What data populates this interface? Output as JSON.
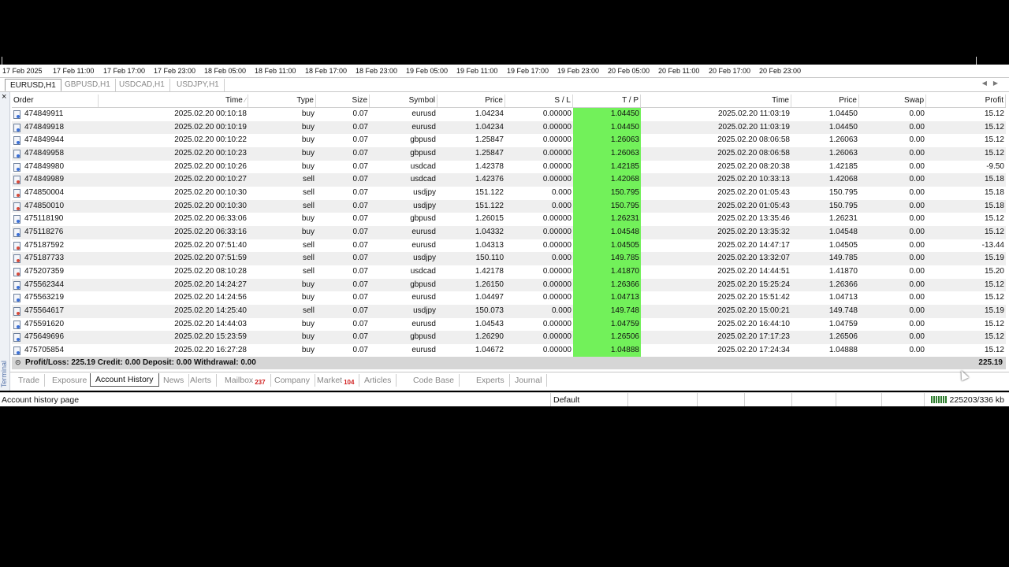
{
  "time_axis": [
    "17 Feb 2025",
    "17 Feb 11:00",
    "17 Feb 17:00",
    "17 Feb 23:00",
    "18 Feb 05:00",
    "18 Feb 11:00",
    "18 Feb 17:00",
    "18 Feb 23:00",
    "19 Feb 05:00",
    "19 Feb 11:00",
    "19 Feb 17:00",
    "19 Feb 23:00",
    "20 Feb 05:00",
    "20 Feb 11:00",
    "20 Feb 17:00",
    "20 Feb 23:00"
  ],
  "chart_tabs": [
    {
      "label": "EURUSD,H1",
      "active": true
    },
    {
      "label": "GBPUSD,H1",
      "active": false
    },
    {
      "label": "USDCAD,H1",
      "active": false
    },
    {
      "label": "USDJPY,H1",
      "active": false
    }
  ],
  "terminal": {
    "close_glyph": "×",
    "side_label": "Terminal",
    "columns": {
      "order": "Order",
      "open_time": "Time",
      "type": "Type",
      "size": "Size",
      "symbol": "Symbol",
      "open_price": "Price",
      "sl": "S / L",
      "tp": "T / P",
      "close_time": "Time",
      "close_price": "Price",
      "swap": "Swap",
      "profit": "Profit"
    },
    "rows": [
      {
        "order": "474849911",
        "open_time": "2025.02.20 00:10:18",
        "type": "buy",
        "size": "0.07",
        "symbol": "eurusd",
        "open_price": "1.04234",
        "sl": "0.00000",
        "tp": "1.04450",
        "close_time": "2025.02.20 11:03:19",
        "close_price": "1.04450",
        "swap": "0.00",
        "profit": "15.12"
      },
      {
        "order": "474849918",
        "open_time": "2025.02.20 00:10:19",
        "type": "buy",
        "size": "0.07",
        "symbol": "eurusd",
        "open_price": "1.04234",
        "sl": "0.00000",
        "tp": "1.04450",
        "close_time": "2025.02.20 11:03:19",
        "close_price": "1.04450",
        "swap": "0.00",
        "profit": "15.12"
      },
      {
        "order": "474849944",
        "open_time": "2025.02.20 00:10:22",
        "type": "buy",
        "size": "0.07",
        "symbol": "gbpusd",
        "open_price": "1.25847",
        "sl": "0.00000",
        "tp": "1.26063",
        "close_time": "2025.02.20 08:06:58",
        "close_price": "1.26063",
        "swap": "0.00",
        "profit": "15.12"
      },
      {
        "order": "474849958",
        "open_time": "2025.02.20 00:10:23",
        "type": "buy",
        "size": "0.07",
        "symbol": "gbpusd",
        "open_price": "1.25847",
        "sl": "0.00000",
        "tp": "1.26063",
        "close_time": "2025.02.20 08:06:58",
        "close_price": "1.26063",
        "swap": "0.00",
        "profit": "15.12"
      },
      {
        "order": "474849980",
        "open_time": "2025.02.20 00:10:26",
        "type": "buy",
        "size": "0.07",
        "symbol": "usdcad",
        "open_price": "1.42378",
        "sl": "0.00000",
        "tp": "1.42185",
        "close_time": "2025.02.20 08:20:38",
        "close_price": "1.42185",
        "swap": "0.00",
        "profit": "-9.50"
      },
      {
        "order": "474849989",
        "open_time": "2025.02.20 00:10:27",
        "type": "sell",
        "size": "0.07",
        "symbol": "usdcad",
        "open_price": "1.42376",
        "sl": "0.00000",
        "tp": "1.42068",
        "close_time": "2025.02.20 10:33:13",
        "close_price": "1.42068",
        "swap": "0.00",
        "profit": "15.18"
      },
      {
        "order": "474850004",
        "open_time": "2025.02.20 00:10:30",
        "type": "sell",
        "size": "0.07",
        "symbol": "usdjpy",
        "open_price": "151.122",
        "sl": "0.000",
        "tp": "150.795",
        "close_time": "2025.02.20 01:05:43",
        "close_price": "150.795",
        "swap": "0.00",
        "profit": "15.18"
      },
      {
        "order": "474850010",
        "open_time": "2025.02.20 00:10:30",
        "type": "sell",
        "size": "0.07",
        "symbol": "usdjpy",
        "open_price": "151.122",
        "sl": "0.000",
        "tp": "150.795",
        "close_time": "2025.02.20 01:05:43",
        "close_price": "150.795",
        "swap": "0.00",
        "profit": "15.18"
      },
      {
        "order": "475118190",
        "open_time": "2025.02.20 06:33:06",
        "type": "buy",
        "size": "0.07",
        "symbol": "gbpusd",
        "open_price": "1.26015",
        "sl": "0.00000",
        "tp": "1.26231",
        "close_time": "2025.02.20 13:35:46",
        "close_price": "1.26231",
        "swap": "0.00",
        "profit": "15.12"
      },
      {
        "order": "475118276",
        "open_time": "2025.02.20 06:33:16",
        "type": "buy",
        "size": "0.07",
        "symbol": "eurusd",
        "open_price": "1.04332",
        "sl": "0.00000",
        "tp": "1.04548",
        "close_time": "2025.02.20 13:35:32",
        "close_price": "1.04548",
        "swap": "0.00",
        "profit": "15.12"
      },
      {
        "order": "475187592",
        "open_time": "2025.02.20 07:51:40",
        "type": "sell",
        "size": "0.07",
        "symbol": "eurusd",
        "open_price": "1.04313",
        "sl": "0.00000",
        "tp": "1.04505",
        "close_time": "2025.02.20 14:47:17",
        "close_price": "1.04505",
        "swap": "0.00",
        "profit": "-13.44"
      },
      {
        "order": "475187733",
        "open_time": "2025.02.20 07:51:59",
        "type": "sell",
        "size": "0.07",
        "symbol": "usdjpy",
        "open_price": "150.110",
        "sl": "0.000",
        "tp": "149.785",
        "close_time": "2025.02.20 13:32:07",
        "close_price": "149.785",
        "swap": "0.00",
        "profit": "15.19"
      },
      {
        "order": "475207359",
        "open_time": "2025.02.20 08:10:28",
        "type": "sell",
        "size": "0.07",
        "symbol": "usdcad",
        "open_price": "1.42178",
        "sl": "0.00000",
        "tp": "1.41870",
        "close_time": "2025.02.20 14:44:51",
        "close_price": "1.41870",
        "swap": "0.00",
        "profit": "15.20"
      },
      {
        "order": "475562344",
        "open_time": "2025.02.20 14:24:27",
        "type": "buy",
        "size": "0.07",
        "symbol": "gbpusd",
        "open_price": "1.26150",
        "sl": "0.00000",
        "tp": "1.26366",
        "close_time": "2025.02.20 15:25:24",
        "close_price": "1.26366",
        "swap": "0.00",
        "profit": "15.12"
      },
      {
        "order": "475563219",
        "open_time": "2025.02.20 14:24:56",
        "type": "buy",
        "size": "0.07",
        "symbol": "eurusd",
        "open_price": "1.04497",
        "sl": "0.00000",
        "tp": "1.04713",
        "close_time": "2025.02.20 15:51:42",
        "close_price": "1.04713",
        "swap": "0.00",
        "profit": "15.12"
      },
      {
        "order": "475564617",
        "open_time": "2025.02.20 14:25:40",
        "type": "sell",
        "size": "0.07",
        "symbol": "usdjpy",
        "open_price": "150.073",
        "sl": "0.000",
        "tp": "149.748",
        "close_time": "2025.02.20 15:00:21",
        "close_price": "149.748",
        "swap": "0.00",
        "profit": "15.19"
      },
      {
        "order": "475591620",
        "open_time": "2025.02.20 14:44:03",
        "type": "buy",
        "size": "0.07",
        "symbol": "eurusd",
        "open_price": "1.04543",
        "sl": "0.00000",
        "tp": "1.04759",
        "close_time": "2025.02.20 16:44:10",
        "close_price": "1.04759",
        "swap": "0.00",
        "profit": "15.12"
      },
      {
        "order": "475649696",
        "open_time": "2025.02.20 15:23:59",
        "type": "buy",
        "size": "0.07",
        "symbol": "gbpusd",
        "open_price": "1.26290",
        "sl": "0.00000",
        "tp": "1.26506",
        "close_time": "2025.02.20 17:17:23",
        "close_price": "1.26506",
        "swap": "0.00",
        "profit": "15.12"
      },
      {
        "order": "475705854",
        "open_time": "2025.02.20 16:27:28",
        "type": "buy",
        "size": "0.07",
        "symbol": "eurusd",
        "open_price": "1.04672",
        "sl": "0.00000",
        "tp": "1.04888",
        "close_time": "2025.02.20 17:24:34",
        "close_price": "1.04888",
        "swap": "0.00",
        "profit": "15.12"
      }
    ],
    "summary": {
      "text": "Profit/Loss: 225.19  Credit: 0.00  Deposit: 0.00  Withdrawal: 0.00",
      "total_profit": "225.19"
    },
    "tabs": [
      {
        "label": "Trade",
        "active": false,
        "badge": ""
      },
      {
        "label": "Exposure",
        "active": false,
        "badge": ""
      },
      {
        "label": "Account History",
        "active": true,
        "badge": ""
      },
      {
        "label": "News",
        "active": false,
        "badge": ""
      },
      {
        "label": "Alerts",
        "active": false,
        "badge": ""
      },
      {
        "label": "Mailbox",
        "active": false,
        "badge": "237"
      },
      {
        "label": "Company",
        "active": false,
        "badge": ""
      },
      {
        "label": "Market",
        "active": false,
        "badge": "104"
      },
      {
        "label": "Articles",
        "active": false,
        "badge": ""
      },
      {
        "label": "Code Base",
        "active": false,
        "badge": ""
      },
      {
        "label": "Experts",
        "active": false,
        "badge": ""
      },
      {
        "label": "Journal",
        "active": false,
        "badge": ""
      }
    ]
  },
  "statusbar": {
    "text": "Account history page",
    "profile": "Default",
    "traffic": "225203/336 kb"
  },
  "colors": {
    "tp_highlight": "#72f15a",
    "badge": "#d02020",
    "summary_bg": "#d6d6d6"
  }
}
